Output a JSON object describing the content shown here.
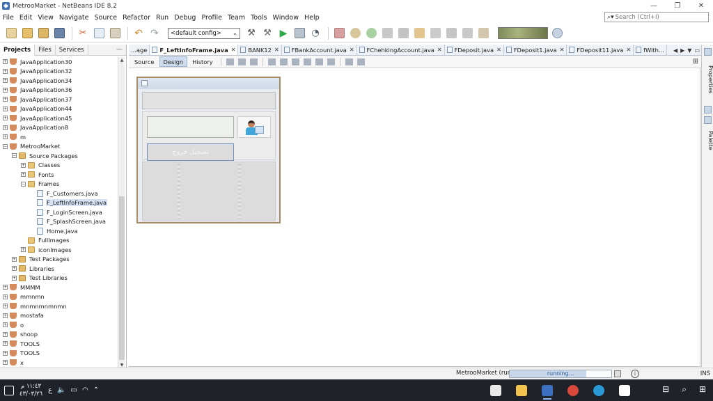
{
  "window": {
    "title": "MetrooMarket - NetBeans IDE 8.2",
    "controls": [
      "—",
      "❐",
      "✕"
    ]
  },
  "menu": [
    "File",
    "Edit",
    "View",
    "Navigate",
    "Source",
    "Refactor",
    "Run",
    "Debug",
    "Profile",
    "Team",
    "Tools",
    "Window",
    "Help"
  ],
  "search": {
    "placeholder": "Search (Ctrl+I)",
    "icon": "magnifier-icon"
  },
  "toolbar": {
    "config": "<default config>",
    "buttons": [
      "new-file-icon",
      "new-project-icon",
      "open-project-icon",
      "save-all-icon",
      "cut-icon",
      "copy-icon",
      "paste-icon",
      "undo-icon",
      "redo-icon"
    ],
    "run_buttons": [
      "build-icon",
      "clean-build-icon",
      "run-icon",
      "debug-icon",
      "profile-icon"
    ],
    "debug_buttons": [
      "finish-session-icon",
      "pause-icon",
      "continue-icon",
      "step-over-icon",
      "step-over-expression-icon",
      "step-into-icon",
      "step-out-icon",
      "run-to-cursor-icon",
      "apply-changes-icon",
      "take-snapshot-icon"
    ]
  },
  "projects_panel": {
    "tabs": [
      "Projects",
      "Files",
      "Services"
    ],
    "minimize": "—",
    "tree": [
      {
        "label": "JavaApplication30",
        "depth": 0,
        "icon": "cup",
        "exp": "+"
      },
      {
        "label": "JavaApplication32",
        "depth": 0,
        "icon": "cup",
        "exp": "+"
      },
      {
        "label": "JavaApplication34",
        "depth": 0,
        "icon": "cup",
        "exp": "+"
      },
      {
        "label": "JavaApplication36",
        "depth": 0,
        "icon": "cup",
        "exp": "+"
      },
      {
        "label": "JavaApplication37",
        "depth": 0,
        "icon": "cup",
        "exp": "+"
      },
      {
        "label": "JavaApplication44",
        "depth": 0,
        "icon": "cup",
        "exp": "+"
      },
      {
        "label": "JavaApplication45",
        "depth": 0,
        "icon": "cup",
        "exp": "+"
      },
      {
        "label": "JavaApplication8",
        "depth": 0,
        "icon": "cup",
        "exp": "+"
      },
      {
        "label": "m",
        "depth": 0,
        "icon": "cup",
        "exp": "+"
      },
      {
        "label": "MetrooMarket",
        "depth": 0,
        "icon": "cup",
        "exp": "−"
      },
      {
        "label": "Source Packages",
        "depth": 1,
        "icon": "pkg",
        "exp": "−"
      },
      {
        "label": "Classes",
        "depth": 2,
        "icon": "folder",
        "exp": "+"
      },
      {
        "label": "Fonts",
        "depth": 2,
        "icon": "folder",
        "exp": "+"
      },
      {
        "label": "Frames",
        "depth": 2,
        "icon": "folder",
        "exp": "−"
      },
      {
        "label": "F_Customers.java",
        "depth": 3,
        "icon": "file",
        "exp": ""
      },
      {
        "label": "F_LeftInfoFrame.java",
        "depth": 3,
        "icon": "file",
        "exp": "",
        "selected": true
      },
      {
        "label": "F_LoginScreen.java",
        "depth": 3,
        "icon": "file",
        "exp": ""
      },
      {
        "label": "F_SplashScreen.java",
        "depth": 3,
        "icon": "file",
        "exp": ""
      },
      {
        "label": "Home.java",
        "depth": 3,
        "icon": "file",
        "exp": ""
      },
      {
        "label": "FullImages",
        "depth": 2,
        "icon": "folder",
        "exp": ""
      },
      {
        "label": "iconImages",
        "depth": 2,
        "icon": "folder",
        "exp": "+"
      },
      {
        "label": "Test Packages",
        "depth": 1,
        "icon": "pkg",
        "exp": "+"
      },
      {
        "label": "Libraries",
        "depth": 1,
        "icon": "pkg",
        "exp": "+"
      },
      {
        "label": "Test Libraries",
        "depth": 1,
        "icon": "pkg",
        "exp": "+"
      },
      {
        "label": "MMMM",
        "depth": 0,
        "icon": "cup",
        "exp": "+"
      },
      {
        "label": "mmnmn",
        "depth": 0,
        "icon": "cup",
        "exp": "+"
      },
      {
        "label": "mnmnmnmnmn",
        "depth": 0,
        "icon": "cup",
        "exp": "+"
      },
      {
        "label": "mostafa",
        "depth": 0,
        "icon": "cup",
        "exp": "+"
      },
      {
        "label": "o",
        "depth": 0,
        "icon": "cup",
        "exp": "+"
      },
      {
        "label": "shoop",
        "depth": 0,
        "icon": "cup",
        "exp": "+"
      },
      {
        "label": "TOOLS",
        "depth": 0,
        "icon": "cup",
        "exp": "+"
      },
      {
        "label": "TOOLS",
        "depth": 0,
        "icon": "cup",
        "exp": "+"
      },
      {
        "label": "x",
        "depth": 0,
        "icon": "cup",
        "exp": "+"
      }
    ]
  },
  "editor_tabs": [
    {
      "label": "...age",
      "active": false,
      "close": false
    },
    {
      "label": "F_LeftInfoFrame.java",
      "active": true,
      "close": true
    },
    {
      "label": "BANK12",
      "active": false,
      "close": true
    },
    {
      "label": "FBankAccount.java",
      "active": false,
      "close": true
    },
    {
      "label": "FChehkingAccount.java",
      "active": false,
      "close": true
    },
    {
      "label": "FDeposit.java",
      "active": false,
      "close": true
    },
    {
      "label": "FDeposit1.java",
      "active": false,
      "close": true
    },
    {
      "label": "FDeposit11.java",
      "active": false,
      "close": true
    },
    {
      "label": "fWith...",
      "active": false,
      "close": false
    }
  ],
  "tab_nav": [
    "◀",
    "▶",
    "▼",
    "▭"
  ],
  "view_tabs": [
    "Source",
    "Design",
    "History"
  ],
  "design_form": {
    "logout_label": "تسجيل خروج"
  },
  "right_dock": [
    "Properties",
    "Palette"
  ],
  "status": {
    "task": "MetrooMarket (run)",
    "progress_text": "running...",
    "progress": 0.75,
    "mode": "INS"
  },
  "taskbar": {
    "time": "١١:٤٣ م",
    "date": "٤٣/٠٣/٢٦",
    "lang": "ع",
    "apps": [
      {
        "name": "java-app-icon",
        "color": "#e9e9e9"
      },
      {
        "name": "file-explorer-icon",
        "color": "#f2c34f"
      },
      {
        "name": "netbeans-icon",
        "color": "#3c6fbd"
      },
      {
        "name": "chrome-icon",
        "color": "#d9483b"
      },
      {
        "name": "edge-icon",
        "color": "#2a9ad6"
      },
      {
        "name": "store-icon",
        "color": "#ffffff"
      }
    ],
    "right_icons": [
      "⊟",
      "⌕",
      "⊞"
    ]
  }
}
